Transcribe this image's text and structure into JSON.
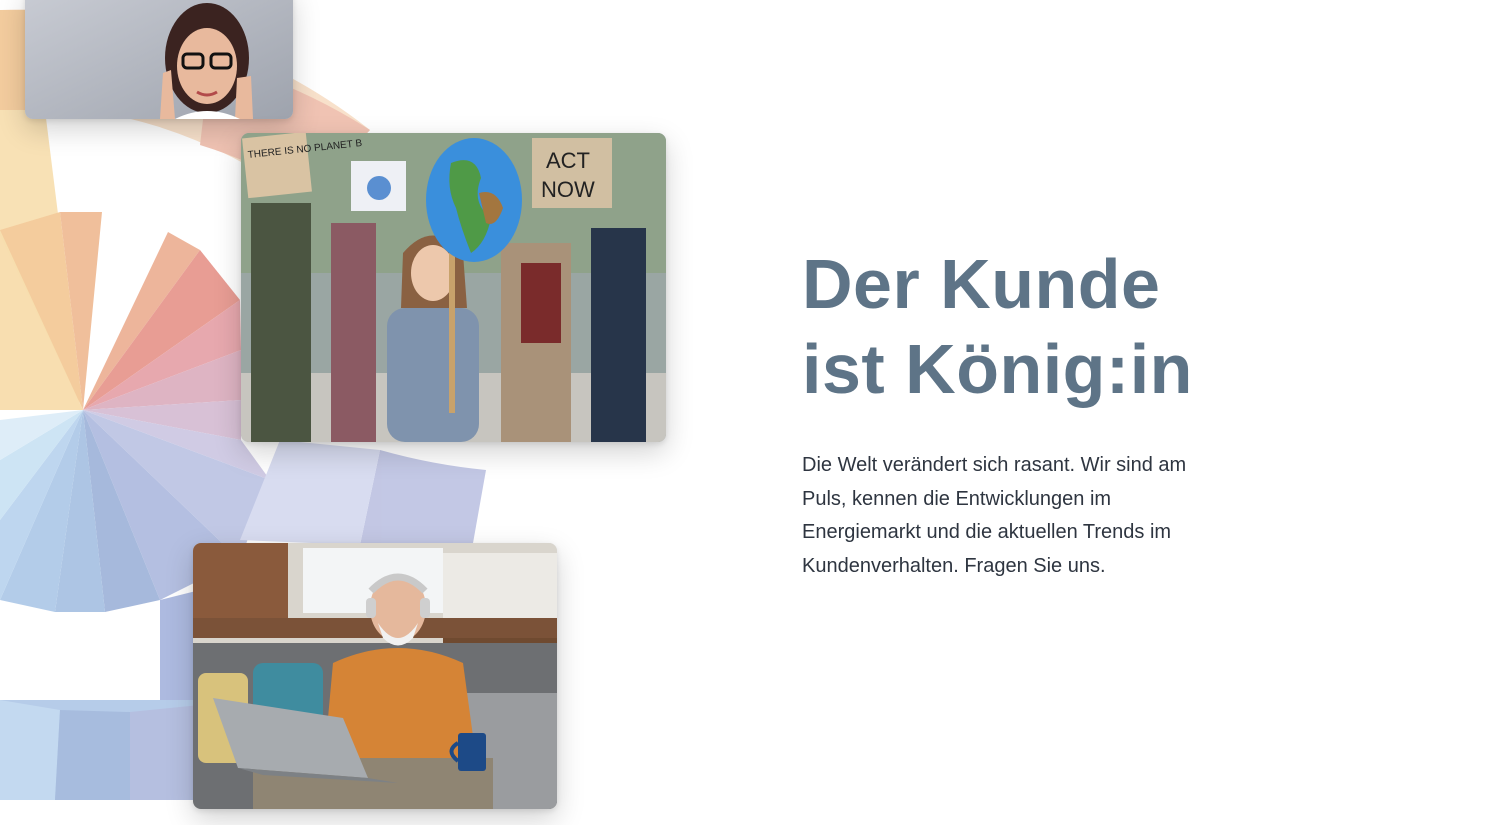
{
  "hero": {
    "headline_line1": "Der Kunde",
    "headline_line2": "ist König:in",
    "body": "Die Welt verändert sich rasant. Wir sind am Puls, kennen die Entwicklungen im Energiemarkt und die aktuellen Trends im Kundenverhalten. Fragen Sie uns."
  },
  "photos": {
    "woman_with_glasses": {
      "icon": "portrait-woman-glasses"
    },
    "climate_protest": {
      "icon": "climate-protest",
      "sign_left": "THERE IS NO PLANET B",
      "sign_right_line1": "ACT",
      "sign_right_line2": "NOW"
    },
    "senior_laptop": {
      "icon": "senior-man-headphones-laptop"
    }
  },
  "colors": {
    "headline": "#5e7487",
    "body_text": "#2e3540",
    "fan_warm": [
      "#f3c98f",
      "#eeb48a",
      "#e79a86",
      "#e08a8f",
      "#dca0b6"
    ],
    "fan_cool": [
      "#b8c0e0",
      "#a9b8dd",
      "#9fb4d8",
      "#a7c8e6",
      "#c2ddf1"
    ]
  }
}
